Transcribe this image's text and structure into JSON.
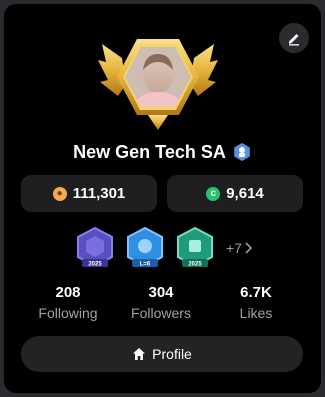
{
  "profile": {
    "name": "New Gen Tech SA",
    "coins": "111,301",
    "gems": "9,614"
  },
  "badges": {
    "labels": [
      "2025",
      "L=6",
      "2025"
    ],
    "more": "+7"
  },
  "stats": [
    {
      "value": "208",
      "label": "Following"
    },
    {
      "value": "304",
      "label": "Followers"
    },
    {
      "value": "6.7K",
      "label": "Likes"
    }
  ],
  "actions": {
    "profile_label": "Profile"
  },
  "colors": {
    "background": "#000000",
    "pill": "#1f1f22",
    "coin": "#f0a85a",
    "gem": "#23c46a",
    "verified": "#5b8fe0",
    "frame_gold": "#e6b43c"
  },
  "icons": [
    "edit-icon",
    "verified-icon",
    "coin-icon",
    "gem-icon",
    "chevron-right-icon",
    "home-icon"
  ]
}
